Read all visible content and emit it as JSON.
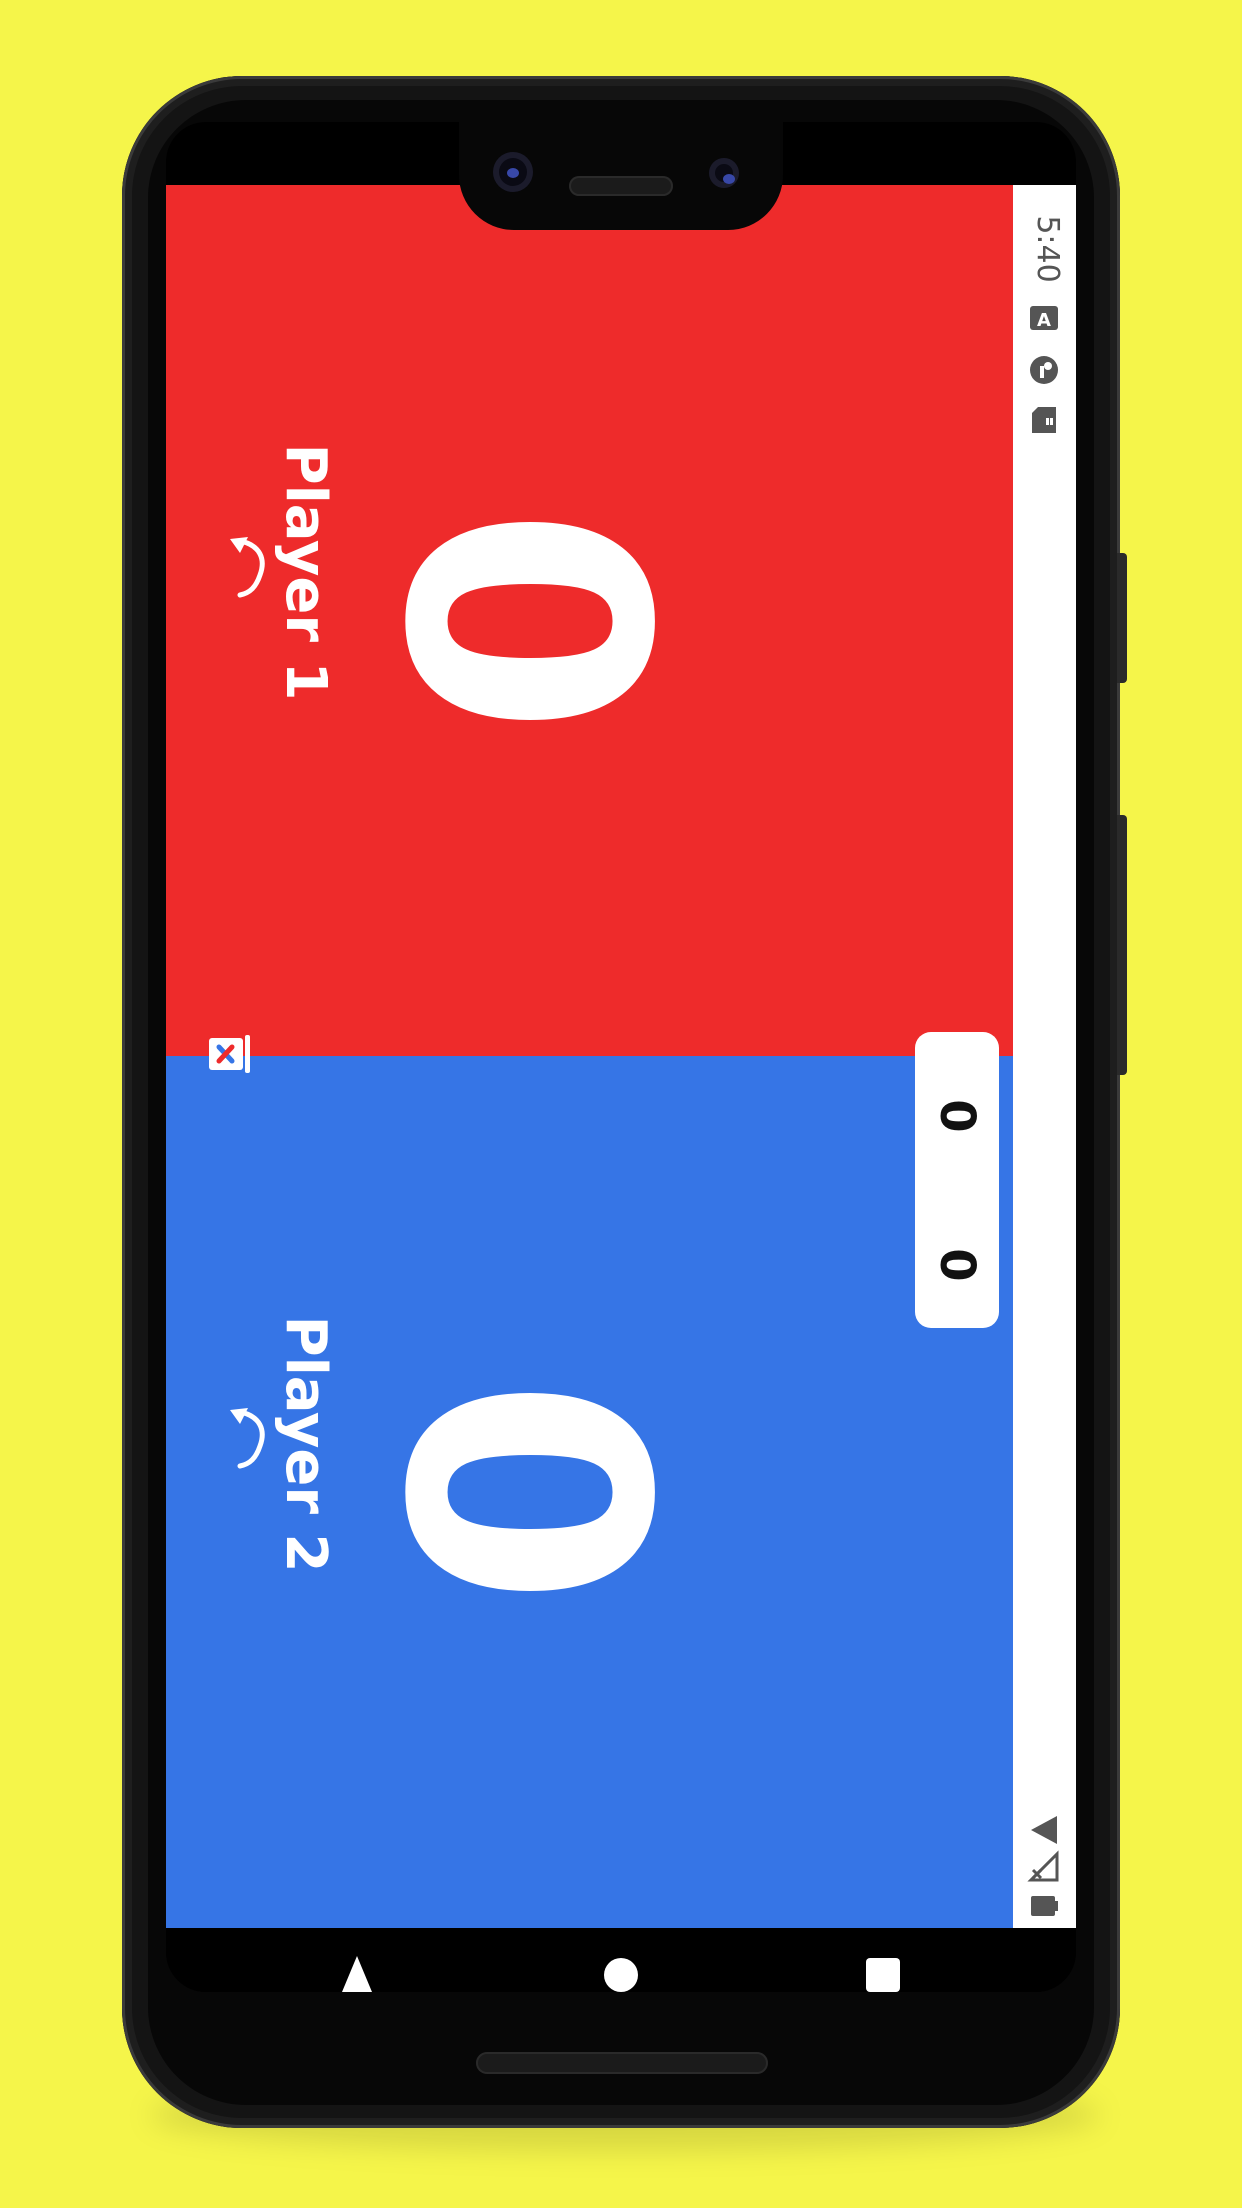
{
  "status_bar": {
    "time": "5:40"
  },
  "players": [
    {
      "name": "Player 1",
      "score": "0",
      "color": "#ee2b2b"
    },
    {
      "name": "Player 2",
      "score": "0",
      "color": "#3675e6"
    }
  ],
  "mini_scores": {
    "player1": "0",
    "player2": "0"
  },
  "icons": {
    "undo": "undo-icon",
    "reset": "reset-scores-icon",
    "nav_back": "back-triangle-icon",
    "nav_home": "home-circle-icon",
    "nav_recents": "recents-square-icon"
  },
  "colors": {
    "background": "#f5f54a",
    "player1": "#ee2b2b",
    "player2": "#3675e6",
    "status_bar": "#ffffff"
  }
}
